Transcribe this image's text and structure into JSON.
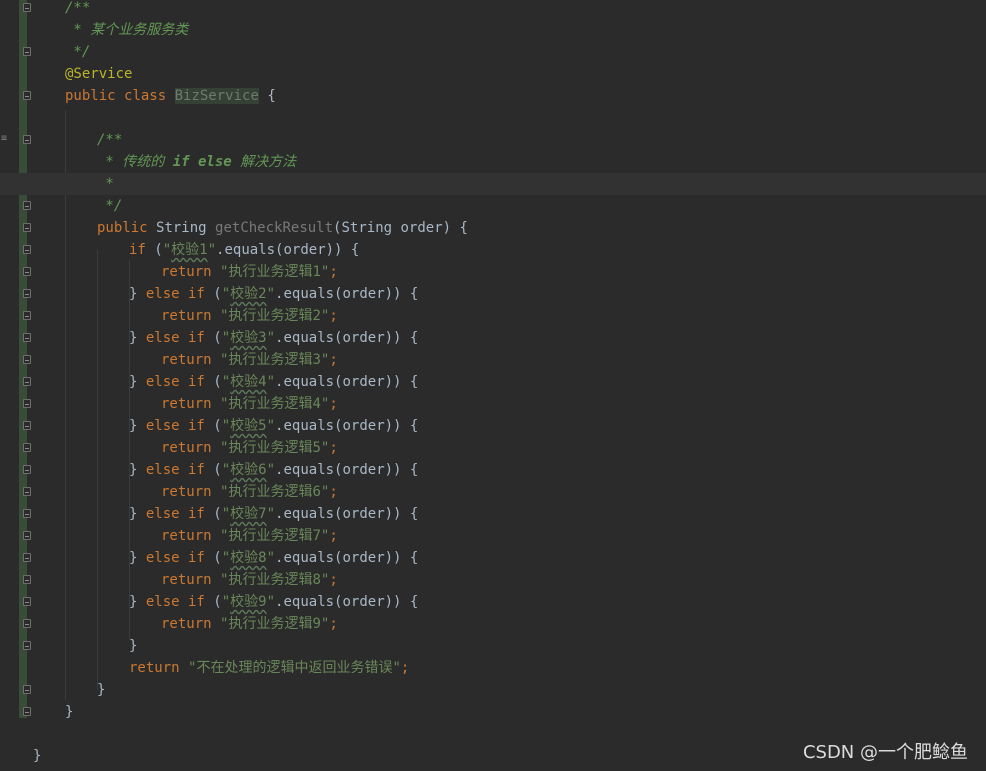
{
  "editor": {
    "lines": [
      {
        "indent": 65,
        "tokens": [
          {
            "t": "/**",
            "c": "doc"
          }
        ]
      },
      {
        "indent": 65,
        "tokens": [
          {
            "t": " * 某个业务服务类",
            "c": "doc"
          }
        ]
      },
      {
        "indent": 65,
        "tokens": [
          {
            "t": " */",
            "c": "doc"
          }
        ]
      },
      {
        "indent": 65,
        "tokens": [
          {
            "t": "@Service",
            "c": "ann"
          }
        ]
      },
      {
        "indent": 65,
        "tokens": [
          {
            "t": "public ",
            "c": "kw"
          },
          {
            "t": "class ",
            "c": "kw"
          },
          {
            "t": "BizService",
            "c": "cls-hl"
          },
          {
            "t": " {",
            "c": ""
          }
        ]
      },
      {
        "indent": 65,
        "tokens": []
      },
      {
        "indent": 97,
        "tokens": [
          {
            "t": "/**",
            "c": "doc"
          }
        ]
      },
      {
        "indent": 97,
        "tokens": [
          {
            "t": " * 传统的 ",
            "c": "doc"
          },
          {
            "t": "if else",
            "c": "doc-tag"
          },
          {
            "t": " 解决方法",
            "c": "doc"
          }
        ]
      },
      {
        "indent": 97,
        "tokens": [
          {
            "t": " *",
            "c": "doc"
          }
        ],
        "current": true
      },
      {
        "indent": 97,
        "tokens": [
          {
            "t": " */",
            "c": "doc"
          }
        ]
      },
      {
        "indent": 97,
        "tokens": [
          {
            "t": "public ",
            "c": "kw"
          },
          {
            "t": "String ",
            "c": ""
          },
          {
            "t": "getCheckResult",
            "c": "fn"
          },
          {
            "t": "(String order) {",
            "c": ""
          }
        ]
      },
      {
        "indent": 129,
        "tokens": [
          {
            "t": "if ",
            "c": "kw"
          },
          {
            "t": "(",
            "c": ""
          },
          {
            "t": "\"",
            "c": "str"
          },
          {
            "t": "校验1",
            "c": "str wavy"
          },
          {
            "t": "\"",
            "c": "str"
          },
          {
            "t": ".equals(order)) {",
            "c": ""
          }
        ]
      },
      {
        "indent": 161,
        "tokens": [
          {
            "t": "return ",
            "c": "kw"
          },
          {
            "t": "\"执行业务逻辑1\"",
            "c": "str"
          },
          {
            "t": ";",
            "c": "kw"
          }
        ]
      },
      {
        "indent": 129,
        "tokens": [
          {
            "t": "} ",
            "c": ""
          },
          {
            "t": "else if ",
            "c": "kw"
          },
          {
            "t": "(",
            "c": ""
          },
          {
            "t": "\"",
            "c": "str"
          },
          {
            "t": "校验2",
            "c": "str wavy"
          },
          {
            "t": "\"",
            "c": "str"
          },
          {
            "t": ".equals(order)) {",
            "c": ""
          }
        ]
      },
      {
        "indent": 161,
        "tokens": [
          {
            "t": "return ",
            "c": "kw"
          },
          {
            "t": "\"执行业务逻辑2\"",
            "c": "str"
          },
          {
            "t": ";",
            "c": "kw"
          }
        ]
      },
      {
        "indent": 129,
        "tokens": [
          {
            "t": "} ",
            "c": ""
          },
          {
            "t": "else if ",
            "c": "kw"
          },
          {
            "t": "(",
            "c": ""
          },
          {
            "t": "\"",
            "c": "str"
          },
          {
            "t": "校验3",
            "c": "str wavy"
          },
          {
            "t": "\"",
            "c": "str"
          },
          {
            "t": ".equals(order)) {",
            "c": ""
          }
        ]
      },
      {
        "indent": 161,
        "tokens": [
          {
            "t": "return ",
            "c": "kw"
          },
          {
            "t": "\"执行业务逻辑3\"",
            "c": "str"
          },
          {
            "t": ";",
            "c": "kw"
          }
        ]
      },
      {
        "indent": 129,
        "tokens": [
          {
            "t": "} ",
            "c": ""
          },
          {
            "t": "else if ",
            "c": "kw"
          },
          {
            "t": "(",
            "c": ""
          },
          {
            "t": "\"",
            "c": "str"
          },
          {
            "t": "校验4",
            "c": "str wavy"
          },
          {
            "t": "\"",
            "c": "str"
          },
          {
            "t": ".equals(order)) {",
            "c": ""
          }
        ]
      },
      {
        "indent": 161,
        "tokens": [
          {
            "t": "return ",
            "c": "kw"
          },
          {
            "t": "\"执行业务逻辑4\"",
            "c": "str"
          },
          {
            "t": ";",
            "c": "kw"
          }
        ]
      },
      {
        "indent": 129,
        "tokens": [
          {
            "t": "} ",
            "c": ""
          },
          {
            "t": "else if ",
            "c": "kw"
          },
          {
            "t": "(",
            "c": ""
          },
          {
            "t": "\"",
            "c": "str"
          },
          {
            "t": "校验5",
            "c": "str wavy"
          },
          {
            "t": "\"",
            "c": "str"
          },
          {
            "t": ".equals(order)) {",
            "c": ""
          }
        ]
      },
      {
        "indent": 161,
        "tokens": [
          {
            "t": "return ",
            "c": "kw"
          },
          {
            "t": "\"执行业务逻辑5\"",
            "c": "str"
          },
          {
            "t": ";",
            "c": "kw"
          }
        ]
      },
      {
        "indent": 129,
        "tokens": [
          {
            "t": "} ",
            "c": ""
          },
          {
            "t": "else if ",
            "c": "kw"
          },
          {
            "t": "(",
            "c": ""
          },
          {
            "t": "\"",
            "c": "str"
          },
          {
            "t": "校验6",
            "c": "str wavy"
          },
          {
            "t": "\"",
            "c": "str"
          },
          {
            "t": ".equals(order)) {",
            "c": ""
          }
        ]
      },
      {
        "indent": 161,
        "tokens": [
          {
            "t": "return ",
            "c": "kw"
          },
          {
            "t": "\"执行业务逻辑6\"",
            "c": "str"
          },
          {
            "t": ";",
            "c": "kw"
          }
        ]
      },
      {
        "indent": 129,
        "tokens": [
          {
            "t": "} ",
            "c": ""
          },
          {
            "t": "else if ",
            "c": "kw"
          },
          {
            "t": "(",
            "c": ""
          },
          {
            "t": "\"",
            "c": "str"
          },
          {
            "t": "校验7",
            "c": "str wavy"
          },
          {
            "t": "\"",
            "c": "str"
          },
          {
            "t": ".equals(order)) {",
            "c": ""
          }
        ]
      },
      {
        "indent": 161,
        "tokens": [
          {
            "t": "return ",
            "c": "kw"
          },
          {
            "t": "\"执行业务逻辑7\"",
            "c": "str"
          },
          {
            "t": ";",
            "c": "kw"
          }
        ]
      },
      {
        "indent": 129,
        "tokens": [
          {
            "t": "} ",
            "c": ""
          },
          {
            "t": "else if ",
            "c": "kw"
          },
          {
            "t": "(",
            "c": ""
          },
          {
            "t": "\"",
            "c": "str"
          },
          {
            "t": "校验8",
            "c": "str wavy"
          },
          {
            "t": "\"",
            "c": "str"
          },
          {
            "t": ".equals(order)) {",
            "c": ""
          }
        ]
      },
      {
        "indent": 161,
        "tokens": [
          {
            "t": "return ",
            "c": "kw"
          },
          {
            "t": "\"执行业务逻辑8\"",
            "c": "str"
          },
          {
            "t": ";",
            "c": "kw"
          }
        ]
      },
      {
        "indent": 129,
        "tokens": [
          {
            "t": "} ",
            "c": ""
          },
          {
            "t": "else if ",
            "c": "kw"
          },
          {
            "t": "(",
            "c": ""
          },
          {
            "t": "\"",
            "c": "str"
          },
          {
            "t": "校验9",
            "c": "str wavy"
          },
          {
            "t": "\"",
            "c": "str"
          },
          {
            "t": ".equals(order)) {",
            "c": ""
          }
        ]
      },
      {
        "indent": 161,
        "tokens": [
          {
            "t": "return ",
            "c": "kw"
          },
          {
            "t": "\"执行业务逻辑9\"",
            "c": "str"
          },
          {
            "t": ";",
            "c": "kw"
          }
        ]
      },
      {
        "indent": 129,
        "tokens": [
          {
            "t": "}",
            "c": ""
          }
        ]
      },
      {
        "indent": 129,
        "tokens": [
          {
            "t": "return ",
            "c": "kw"
          },
          {
            "t": "\"不在处理的逻辑中返回业务错误\"",
            "c": "str"
          },
          {
            "t": ";",
            "c": "kw"
          }
        ]
      },
      {
        "indent": 97,
        "tokens": [
          {
            "t": "}",
            "c": ""
          }
        ]
      },
      {
        "indent": 65,
        "tokens": [
          {
            "t": "}",
            "c": ""
          }
        ]
      },
      {
        "indent": 65,
        "tokens": []
      },
      {
        "indent": 33,
        "tokens": [
          {
            "t": "}",
            "c": ""
          }
        ]
      }
    ]
  },
  "watermark": "CSDN @一个肥鲶鱼"
}
